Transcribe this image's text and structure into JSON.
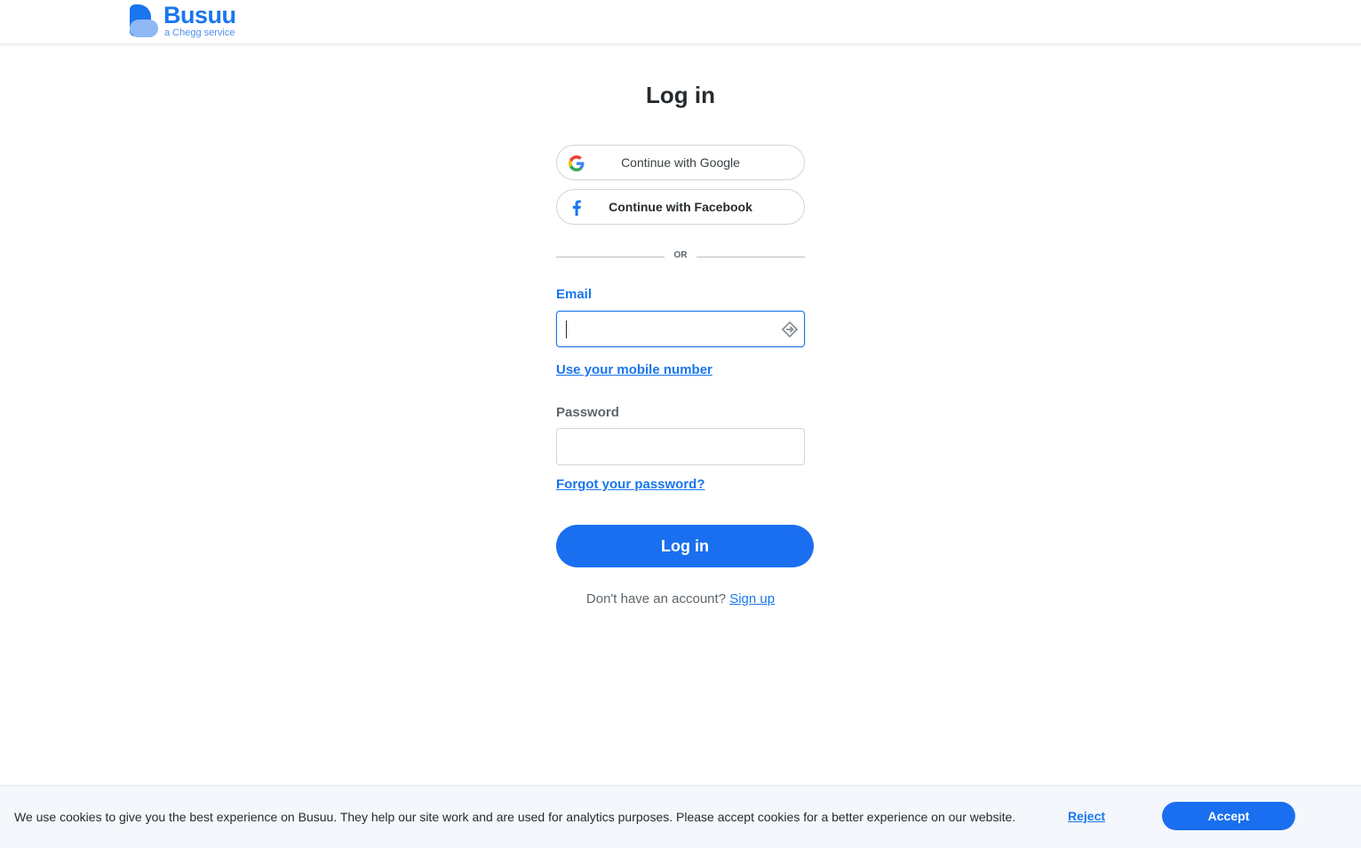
{
  "header": {
    "brand": "Busuu",
    "brand_sub": "a Chegg service"
  },
  "login": {
    "title": "Log in",
    "google_label": "Continue with Google",
    "facebook_label": "Continue with Facebook",
    "divider_label": "OR",
    "email_label": "Email",
    "email_value": "",
    "mobile_link": "Use your mobile number",
    "password_label": "Password",
    "password_value": "",
    "forgot_link": "Forgot your password?",
    "submit_label": "Log in",
    "no_account_text": "Don't have an account?",
    "signup_link": "Sign up"
  },
  "cookie": {
    "message": "We use cookies to give you the best experience on Busuu. They help our site work and are used for analytics purposes. Please accept cookies for a better experience on our website.",
    "reject_label": "Reject",
    "accept_label": "Accept"
  },
  "colors": {
    "accent": "#1976ee",
    "button": "#1a6ff0",
    "facebook": "#1877f2"
  }
}
